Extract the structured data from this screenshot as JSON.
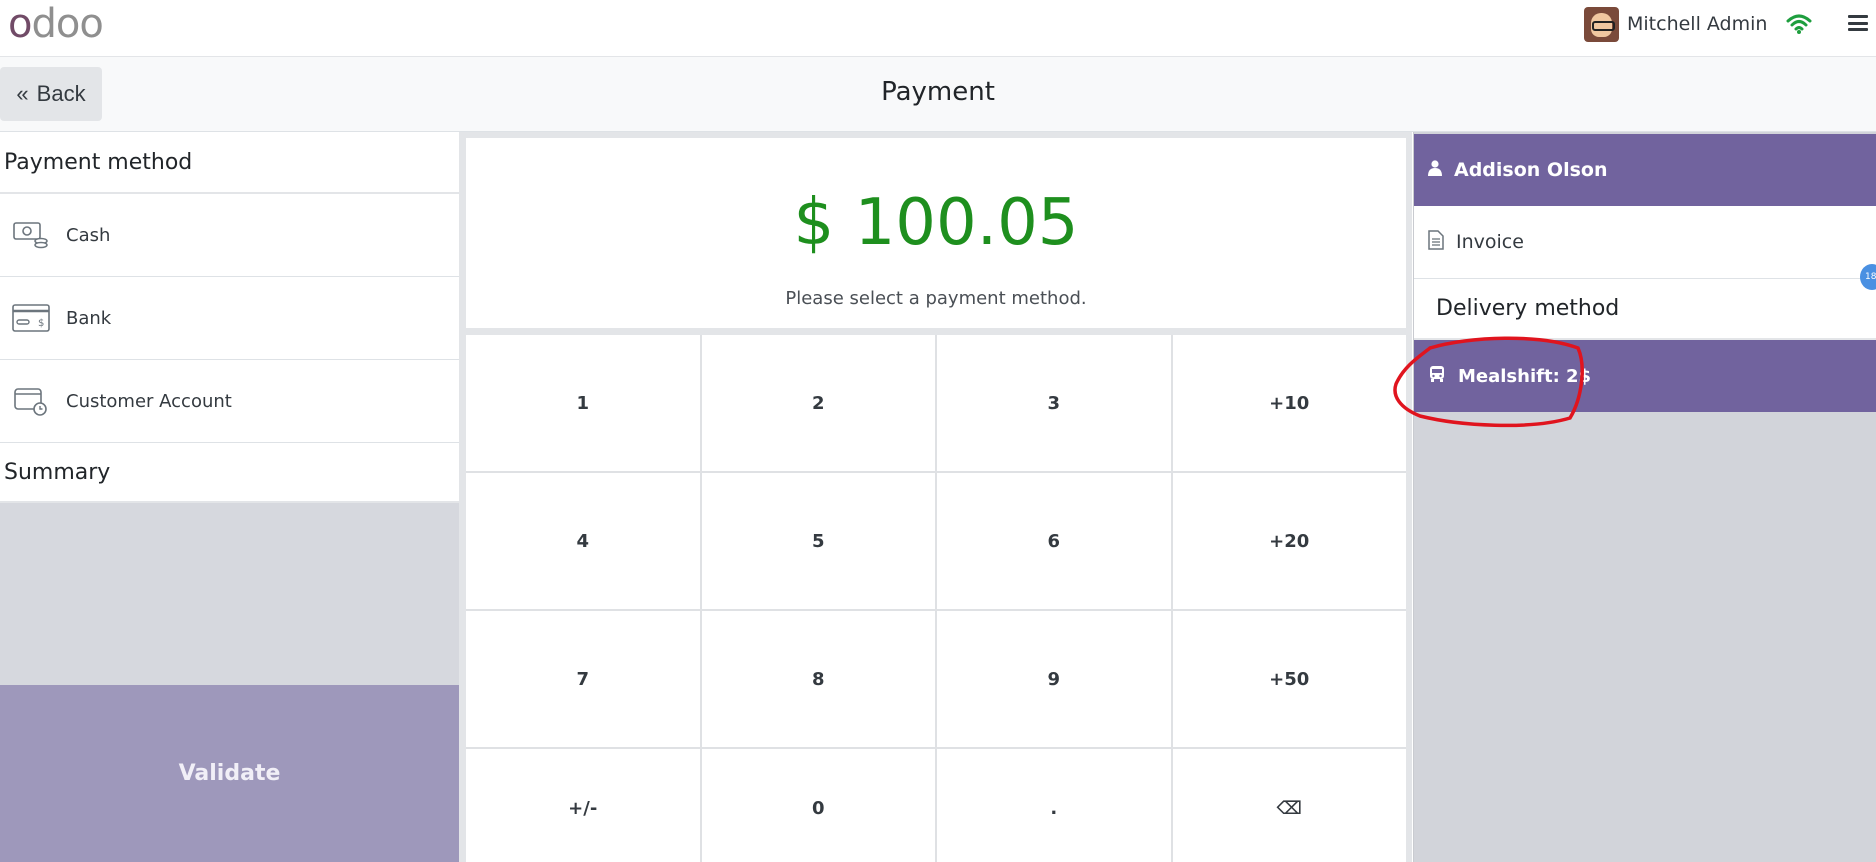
{
  "navbar": {
    "logo_text": "odoo",
    "user_name": "Mitchell Admin"
  },
  "header": {
    "back_label": "Back",
    "title": "Payment"
  },
  "payment_methods": {
    "title": "Payment method",
    "items": [
      {
        "label": "Cash",
        "icon": "cash-icon"
      },
      {
        "label": "Bank",
        "icon": "bank-card-icon"
      },
      {
        "label": "Customer Account",
        "icon": "customer-account-icon"
      }
    ]
  },
  "summary": {
    "title": "Summary"
  },
  "validate_label": "Validate",
  "amount": {
    "value": "$ 100.05",
    "hint": "Please select a payment method.",
    "color": "#1e8f1e"
  },
  "numpad": {
    "keys": [
      "1",
      "2",
      "3",
      "+10",
      "4",
      "5",
      "6",
      "+20",
      "7",
      "8",
      "9",
      "+50",
      "+/-",
      "0",
      ".",
      "⌫"
    ]
  },
  "right_panel": {
    "customer_name": "Addison Olson",
    "invoice_label": "Invoice",
    "delivery_title": "Delivery method",
    "delivery_selected": "Mealshift: 2$",
    "notification_count": "18"
  },
  "colors": {
    "primary": "#71639e",
    "validate_disabled": "#9e98bb",
    "annotation": "#e0141e"
  }
}
